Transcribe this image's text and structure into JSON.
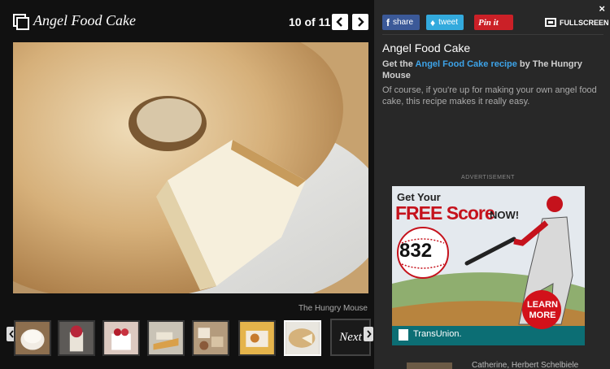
{
  "gallery": {
    "title": "Angel Food Cake",
    "counter": "10 of 11",
    "credit": "The Hungry Mouse",
    "next_label": "Next",
    "thumb_count": 7,
    "active_thumb_index": 7
  },
  "side": {
    "close_glyph": "×",
    "share": {
      "facebook": "share",
      "twitter": "tweet",
      "pinterest": "Pin it"
    },
    "fullscreen_label": "FULLSCREEN",
    "title": "Angel Food Cake",
    "recipe_prefix": "Get the ",
    "recipe_link": "Angel Food Cake recipe",
    "recipe_suffix": " by The Hungry Mouse",
    "description": "Of course, if you're up for making your own angel food cake, this recipe makes it really easy.",
    "ad_label": "ADVERTISEMENT",
    "footer_text": "Catherine, Herbert Schelbiele"
  },
  "ad": {
    "line1": "Get Your",
    "line2": "FREE Score",
    "line2b": "NOW!",
    "score": "832",
    "cta": "LEARN MORE",
    "brand": "TransUnion."
  },
  "colors": {
    "facebook": "#3b5998",
    "twitter": "#33aadd",
    "pinterest": "#cb2027",
    "link": "#3da3e8",
    "ad_red": "#c5121c"
  },
  "icons": [
    "gallery-icon",
    "chevron-left-icon",
    "chevron-right-icon",
    "close-icon",
    "facebook-icon",
    "twitter-icon",
    "fullscreen-icon"
  ]
}
